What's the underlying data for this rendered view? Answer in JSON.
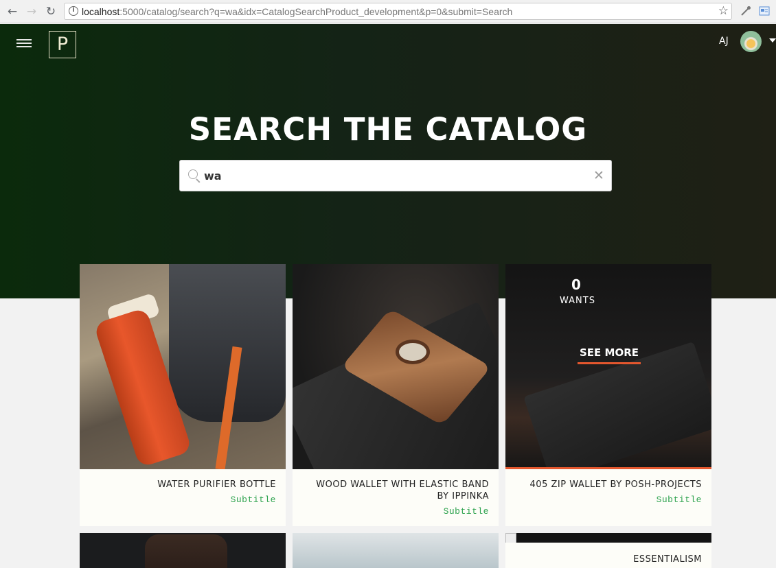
{
  "browser": {
    "url_host": "localhost",
    "url_rest": ":5000/catalog/search?q=wa&idx=CatalogSearchProduct_development&p=0&submit=Search"
  },
  "header": {
    "logo_letter": "P",
    "user_initials": "AJ"
  },
  "hero": {
    "title": "SEARCH THE CATALOG"
  },
  "search": {
    "value": "wa",
    "placeholder": ""
  },
  "products": [
    {
      "title": "WATER PURIFIER BOTTLE",
      "subtitle": "Subtitle"
    },
    {
      "title": "WOOD WALLET WITH ELASTIC BAND BY IPPINKA",
      "subtitle": "Subtitle"
    },
    {
      "title": "405 ZIP WALLET BY POSH-PROJECTS",
      "subtitle": "Subtitle",
      "wants_count": "0",
      "wants_label": "WANTS",
      "see_more_label": "SEE MORE"
    },
    {
      "title": "",
      "subtitle": ""
    },
    {
      "title": "",
      "subtitle": ""
    },
    {
      "title": "ESSENTIALISM",
      "subtitle": ""
    }
  ],
  "colors": {
    "accent": "#e4572e",
    "subtitle_green": "#2ea34f",
    "hero_bg_left": "#0b2a0c",
    "hero_bg_right": "#1f2015"
  }
}
